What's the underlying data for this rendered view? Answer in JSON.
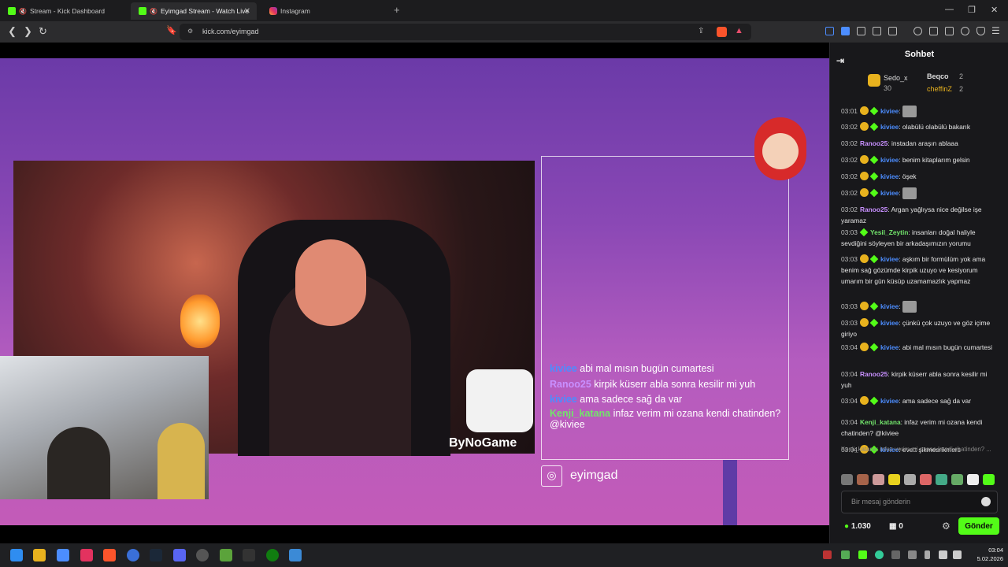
{
  "browser": {
    "tabs": [
      {
        "title": "Stream - Kick Dashboard",
        "icon": "kick-icon"
      },
      {
        "title": "Eyimgad Stream - Watch Live",
        "icon": "kick-icon"
      },
      {
        "title": "Instagram",
        "icon": "instagram-icon"
      }
    ],
    "new_tab": "+",
    "url": "kick.com/eyimgad"
  },
  "stream": {
    "overlay_chat": [
      {
        "user": "kiviee",
        "text": "abi mal mısın bugün cumartesi",
        "color": "#4c8dff"
      },
      {
        "user": "Ranoo25",
        "text": "kirpik küserr abla sonra kesilir mi yuh",
        "color": "#c890ff"
      },
      {
        "user": "kiviee",
        "text": "ama sadece sağ da var",
        "color": "#4c8dff"
      },
      {
        "user": "Kenji_katana",
        "text": "infaz verim mi ozana kendi chatinden? @kiviee",
        "color": "#72e46b"
      }
    ],
    "sponsor": "ByNoGame",
    "instagram_handle": "eyimgad"
  },
  "chat": {
    "title": "Sohbet",
    "leaderboard": [
      {
        "name": "Sedo_x",
        "value": "30"
      },
      {
        "name": "Beqco",
        "value": "2"
      },
      {
        "name": "cheffinZ",
        "value": "2"
      }
    ],
    "messages": [
      {
        "time": "03:01",
        "user": "kiviee",
        "text": "",
        "emote": true,
        "badges": 2,
        "cls": "uk"
      },
      {
        "time": "03:02",
        "user": "kiviee",
        "text": "olabülü olabülü bakarık",
        "badges": 2,
        "cls": "uk"
      },
      {
        "time": "03:02",
        "user": "Ranoo25",
        "text": "instadan araşın ablaaa",
        "badges": 0,
        "cls": "ur"
      },
      {
        "time": "03:02",
        "user": "kiviee",
        "text": "benim kitaplarım gelsin",
        "badges": 2,
        "cls": "uk"
      },
      {
        "time": "03:02",
        "user": "kiviee",
        "text": "öşek",
        "badges": 2,
        "cls": "uk"
      },
      {
        "time": "03:02",
        "user": "kiviee",
        "text": "",
        "emote": true,
        "badges": 2,
        "cls": "uk"
      },
      {
        "time": "03:02",
        "user": "Ranoo25",
        "text": "Argan yağlıysa nice değilse işe yaramaz",
        "badges": 0,
        "cls": "ur"
      },
      {
        "time": "03:03",
        "user": "Yesil_Zeytin",
        "text": "insanları doğal haliyle sevdiğini söyleyen bir arkadaşımızın yorumu",
        "badges": 1,
        "cls": "ug"
      },
      {
        "time": "03:03",
        "user": "kiviee",
        "text": "aşkım bir formülüm yok ama benim sağ gözümde kirpik uzuyo ve kesiyorum umarım bir gün küsüp uzamamazlık yapmaz",
        "badges": 2,
        "cls": "uk"
      },
      {
        "time": "03:03",
        "user": "kiviee",
        "text": "",
        "emote": true,
        "badges": 2,
        "cls": "uk"
      },
      {
        "time": "03:03",
        "user": "kiviee",
        "text": "çünkü çok uzuyo ve göz içime giriyo",
        "badges": 2,
        "cls": "uk"
      },
      {
        "time": "03:04",
        "user": "kiviee",
        "text": "abi mal mısın bugün cumartesi",
        "badges": 2,
        "cls": "uk"
      },
      {
        "time": "03:04",
        "user": "Ranoo25",
        "text": "kirpik küserr abla sonra kesilir mi yuh",
        "badges": 0,
        "cls": "ur"
      },
      {
        "time": "03:04",
        "user": "kiviee",
        "text": "ama sadece sağ da var",
        "badges": 2,
        "cls": "uk"
      },
      {
        "time": "03:04",
        "user": "Kenji_katana",
        "text": "infaz verim mi ozana kendi chatinden? @kiviee",
        "badges": 0,
        "cls": "ug"
      },
      {
        "time": "03:04",
        "user": "kiviee",
        "text": "evett şikmesrikmers",
        "badges": 2,
        "cls": "uk"
      }
    ],
    "reply_preview": "Kenji_katana: infaz verim mi ozana kendi chatinden? ...",
    "input_placeholder": "Bir mesaj gönderin",
    "points": "1.030",
    "bank": "0",
    "send_label": "Gönder"
  },
  "taskbar": {
    "time": "03:04",
    "date": "5.02.2026"
  },
  "colors": {
    "kick_green": "#53fc18",
    "chat_bg": "#18181b"
  }
}
